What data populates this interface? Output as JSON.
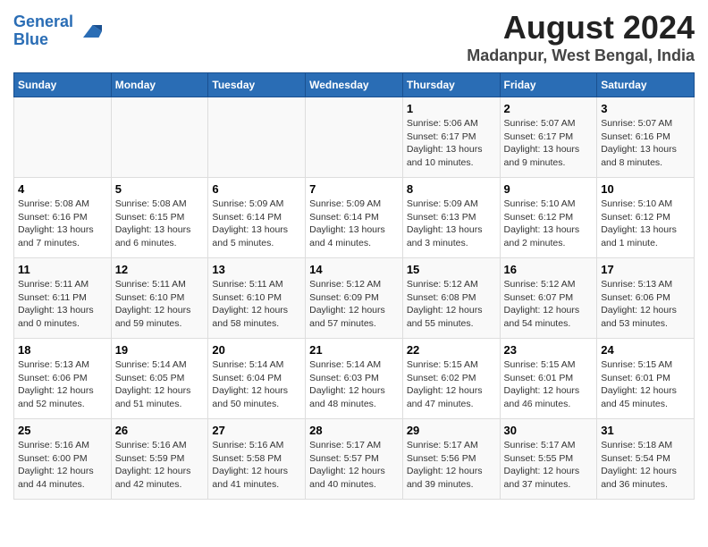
{
  "logo": {
    "line1": "General",
    "line2": "Blue"
  },
  "title": "August 2024",
  "subtitle": "Madanpur, West Bengal, India",
  "headers": [
    "Sunday",
    "Monday",
    "Tuesday",
    "Wednesday",
    "Thursday",
    "Friday",
    "Saturday"
  ],
  "weeks": [
    [
      {
        "day": "",
        "info": ""
      },
      {
        "day": "",
        "info": ""
      },
      {
        "day": "",
        "info": ""
      },
      {
        "day": "",
        "info": ""
      },
      {
        "day": "1",
        "info": "Sunrise: 5:06 AM\nSunset: 6:17 PM\nDaylight: 13 hours\nand 10 minutes."
      },
      {
        "day": "2",
        "info": "Sunrise: 5:07 AM\nSunset: 6:17 PM\nDaylight: 13 hours\nand 9 minutes."
      },
      {
        "day": "3",
        "info": "Sunrise: 5:07 AM\nSunset: 6:16 PM\nDaylight: 13 hours\nand 8 minutes."
      }
    ],
    [
      {
        "day": "4",
        "info": "Sunrise: 5:08 AM\nSunset: 6:16 PM\nDaylight: 13 hours\nand 7 minutes."
      },
      {
        "day": "5",
        "info": "Sunrise: 5:08 AM\nSunset: 6:15 PM\nDaylight: 13 hours\nand 6 minutes."
      },
      {
        "day": "6",
        "info": "Sunrise: 5:09 AM\nSunset: 6:14 PM\nDaylight: 13 hours\nand 5 minutes."
      },
      {
        "day": "7",
        "info": "Sunrise: 5:09 AM\nSunset: 6:14 PM\nDaylight: 13 hours\nand 4 minutes."
      },
      {
        "day": "8",
        "info": "Sunrise: 5:09 AM\nSunset: 6:13 PM\nDaylight: 13 hours\nand 3 minutes."
      },
      {
        "day": "9",
        "info": "Sunrise: 5:10 AM\nSunset: 6:12 PM\nDaylight: 13 hours\nand 2 minutes."
      },
      {
        "day": "10",
        "info": "Sunrise: 5:10 AM\nSunset: 6:12 PM\nDaylight: 13 hours\nand 1 minute."
      }
    ],
    [
      {
        "day": "11",
        "info": "Sunrise: 5:11 AM\nSunset: 6:11 PM\nDaylight: 13 hours\nand 0 minutes."
      },
      {
        "day": "12",
        "info": "Sunrise: 5:11 AM\nSunset: 6:10 PM\nDaylight: 12 hours\nand 59 minutes."
      },
      {
        "day": "13",
        "info": "Sunrise: 5:11 AM\nSunset: 6:10 PM\nDaylight: 12 hours\nand 58 minutes."
      },
      {
        "day": "14",
        "info": "Sunrise: 5:12 AM\nSunset: 6:09 PM\nDaylight: 12 hours\nand 57 minutes."
      },
      {
        "day": "15",
        "info": "Sunrise: 5:12 AM\nSunset: 6:08 PM\nDaylight: 12 hours\nand 55 minutes."
      },
      {
        "day": "16",
        "info": "Sunrise: 5:12 AM\nSunset: 6:07 PM\nDaylight: 12 hours\nand 54 minutes."
      },
      {
        "day": "17",
        "info": "Sunrise: 5:13 AM\nSunset: 6:06 PM\nDaylight: 12 hours\nand 53 minutes."
      }
    ],
    [
      {
        "day": "18",
        "info": "Sunrise: 5:13 AM\nSunset: 6:06 PM\nDaylight: 12 hours\nand 52 minutes."
      },
      {
        "day": "19",
        "info": "Sunrise: 5:14 AM\nSunset: 6:05 PM\nDaylight: 12 hours\nand 51 minutes."
      },
      {
        "day": "20",
        "info": "Sunrise: 5:14 AM\nSunset: 6:04 PM\nDaylight: 12 hours\nand 50 minutes."
      },
      {
        "day": "21",
        "info": "Sunrise: 5:14 AM\nSunset: 6:03 PM\nDaylight: 12 hours\nand 48 minutes."
      },
      {
        "day": "22",
        "info": "Sunrise: 5:15 AM\nSunset: 6:02 PM\nDaylight: 12 hours\nand 47 minutes."
      },
      {
        "day": "23",
        "info": "Sunrise: 5:15 AM\nSunset: 6:01 PM\nDaylight: 12 hours\nand 46 minutes."
      },
      {
        "day": "24",
        "info": "Sunrise: 5:15 AM\nSunset: 6:01 PM\nDaylight: 12 hours\nand 45 minutes."
      }
    ],
    [
      {
        "day": "25",
        "info": "Sunrise: 5:16 AM\nSunset: 6:00 PM\nDaylight: 12 hours\nand 44 minutes."
      },
      {
        "day": "26",
        "info": "Sunrise: 5:16 AM\nSunset: 5:59 PM\nDaylight: 12 hours\nand 42 minutes."
      },
      {
        "day": "27",
        "info": "Sunrise: 5:16 AM\nSunset: 5:58 PM\nDaylight: 12 hours\nand 41 minutes."
      },
      {
        "day": "28",
        "info": "Sunrise: 5:17 AM\nSunset: 5:57 PM\nDaylight: 12 hours\nand 40 minutes."
      },
      {
        "day": "29",
        "info": "Sunrise: 5:17 AM\nSunset: 5:56 PM\nDaylight: 12 hours\nand 39 minutes."
      },
      {
        "day": "30",
        "info": "Sunrise: 5:17 AM\nSunset: 5:55 PM\nDaylight: 12 hours\nand 37 minutes."
      },
      {
        "day": "31",
        "info": "Sunrise: 5:18 AM\nSunset: 5:54 PM\nDaylight: 12 hours\nand 36 minutes."
      }
    ]
  ]
}
